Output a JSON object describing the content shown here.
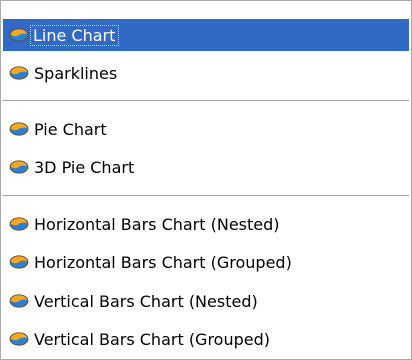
{
  "menu": {
    "selected_index": 0,
    "icon": "chart-icon",
    "items": [
      {
        "label": "Line Chart"
      },
      {
        "label": "Sparklines"
      },
      {
        "label": "Pie Chart"
      },
      {
        "label": "3D Pie Chart"
      },
      {
        "label": "Horizontal Bars Chart (Nested)"
      },
      {
        "label": "Horizontal Bars Chart (Grouped)"
      },
      {
        "label": "Vertical Bars Chart (Nested)"
      },
      {
        "label": "Vertical Bars Chart (Grouped)"
      }
    ]
  },
  "colors": {
    "selection": "#316ac5",
    "selection_text": "#ffffff",
    "separator": "#a5a5a5",
    "icon_orange": "#f5a623",
    "icon_blue": "#2c7fd6"
  }
}
